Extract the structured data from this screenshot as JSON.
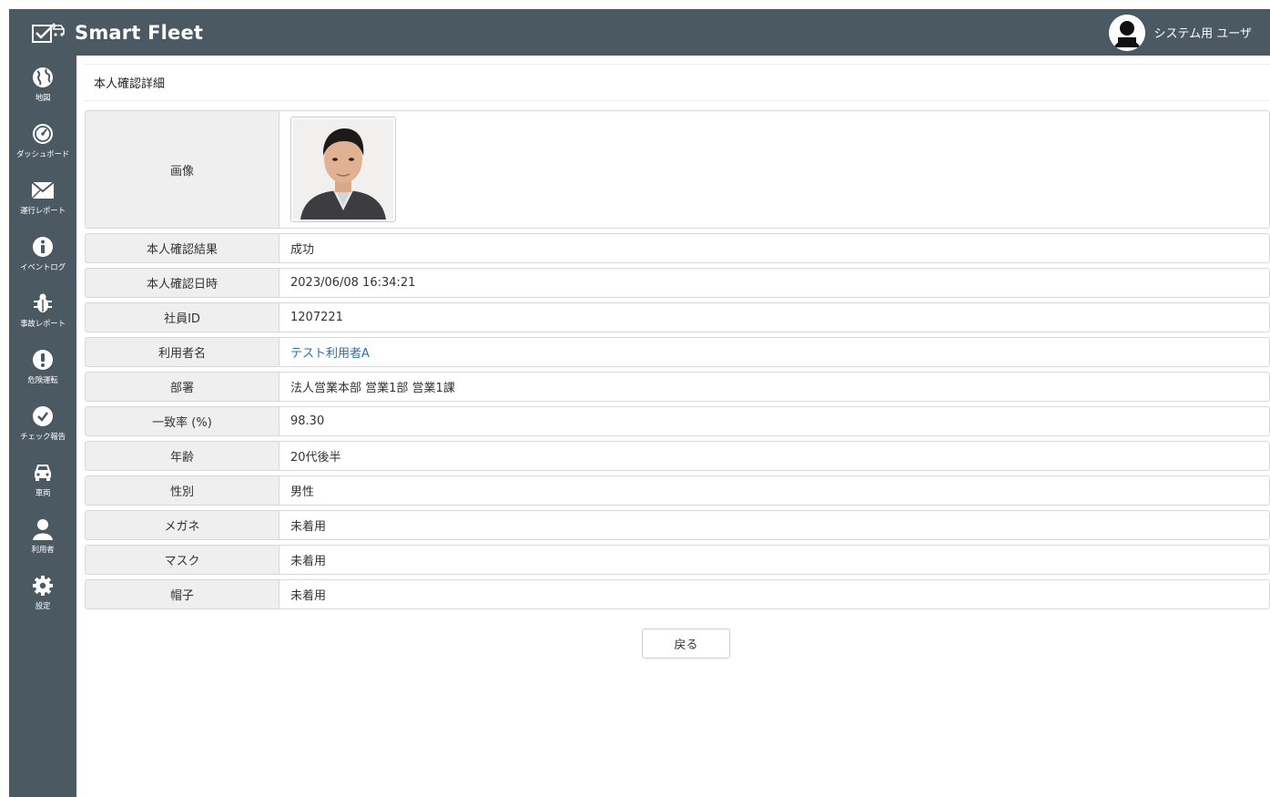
{
  "app": {
    "title": "Smart Fleet",
    "user_name": "システム用 ユーザ"
  },
  "sidebar": {
    "items": [
      {
        "label": "地図",
        "icon": "globe-icon"
      },
      {
        "label": "ダッシュボード",
        "icon": "dashboard-gauge-icon"
      },
      {
        "label": "運行レポート",
        "icon": "envelope-icon"
      },
      {
        "label": "イベントログ",
        "icon": "info-icon"
      },
      {
        "label": "事故レポート",
        "icon": "bug-icon"
      },
      {
        "label": "危険運転",
        "icon": "exclamation-icon"
      },
      {
        "label": "チェック報告",
        "icon": "check-circle-icon"
      },
      {
        "label": "車両",
        "icon": "car-icon"
      },
      {
        "label": "利用者",
        "icon": "user-icon"
      },
      {
        "label": "設定",
        "icon": "gear-icon"
      }
    ]
  },
  "page": {
    "title": "本人確認詳細"
  },
  "detail": {
    "image_label": "画像",
    "rows": [
      {
        "label": "本人確認結果",
        "value": "成功"
      },
      {
        "label": "本人確認日時",
        "value": "2023/06/08 16:34:21"
      },
      {
        "label": "社員ID",
        "value": "1207221"
      },
      {
        "label": "利用者名",
        "value": "テスト利用者A",
        "link": true
      },
      {
        "label": "部署",
        "value": "法人営業本部 営業1部 営業1課"
      },
      {
        "label": "一致率 (%)",
        "value": "98.30"
      },
      {
        "label": "年齢",
        "value": "20代後半"
      },
      {
        "label": "性別",
        "value": "男性"
      },
      {
        "label": "メガネ",
        "value": "未着用"
      },
      {
        "label": "マスク",
        "value": "未着用"
      },
      {
        "label": "帽子",
        "value": "未着用"
      }
    ]
  },
  "actions": {
    "back_label": "戻る"
  },
  "colors": {
    "header_bg": "#4b5963",
    "link": "#2a6fb0",
    "label_bg": "#efefef"
  }
}
